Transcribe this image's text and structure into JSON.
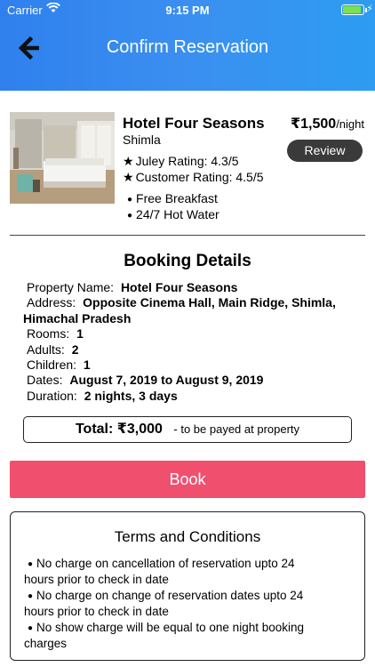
{
  "status_bar": {
    "carrier": "Carrier",
    "time": "9:15 PM",
    "wifi_icon": "wifi-icon",
    "battery_icon": "battery-charging-icon"
  },
  "header": {
    "title": "Confirm Reservation",
    "back_icon": "arrow-left-icon",
    "gradient_start": "#2f80ed",
    "gradient_end": "#2d9cf2"
  },
  "hotel": {
    "name": "Hotel Four Seasons",
    "city": "Shimla",
    "price": "₹1,500",
    "price_unit": "/night",
    "review_label": "Review",
    "ratings": [
      {
        "icon": "star-icon",
        "text": "Juley Rating: 4.3/5"
      },
      {
        "icon": "star-icon",
        "text": "Customer Rating: 4.5/5"
      }
    ],
    "amenities": [
      "Free Breakfast",
      "24/7 Hot Water"
    ]
  },
  "booking": {
    "title": "Booking Details",
    "property_label": "Property Name:",
    "property_value": "Hotel Four Seasons",
    "address_label": "Address:",
    "address_value": "Opposite Cinema Hall, Main Ridge, Shimla,",
    "address_value_2": "Himachal Pradesh",
    "rooms_label": "Rooms:",
    "rooms_value": "1",
    "adults_label": "Adults:",
    "adults_value": "2",
    "children_label": "Children:",
    "children_value": "1",
    "dates_label": "Dates:",
    "dates_value": "August 7, 2019 to August 9, 2019",
    "duration_label": "Duration:",
    "duration_value": "2 nights, 3 days"
  },
  "total": {
    "label": "Total:",
    "amount": "₹3,000",
    "note": "- to be payed at property"
  },
  "book_button": {
    "label": "Book",
    "color": "#f0506e"
  },
  "terms": {
    "title": "Terms and Conditions",
    "items": [
      {
        "line1": "No charge on cancellation of reservation upto 24",
        "line2": "hours prior to check in date"
      },
      {
        "line1": "No charge on change of reservation dates upto 24",
        "line2": "hours prior to check in date"
      },
      {
        "line1": "No show charge will be equal to one night booking",
        "line2": "charges"
      }
    ]
  }
}
